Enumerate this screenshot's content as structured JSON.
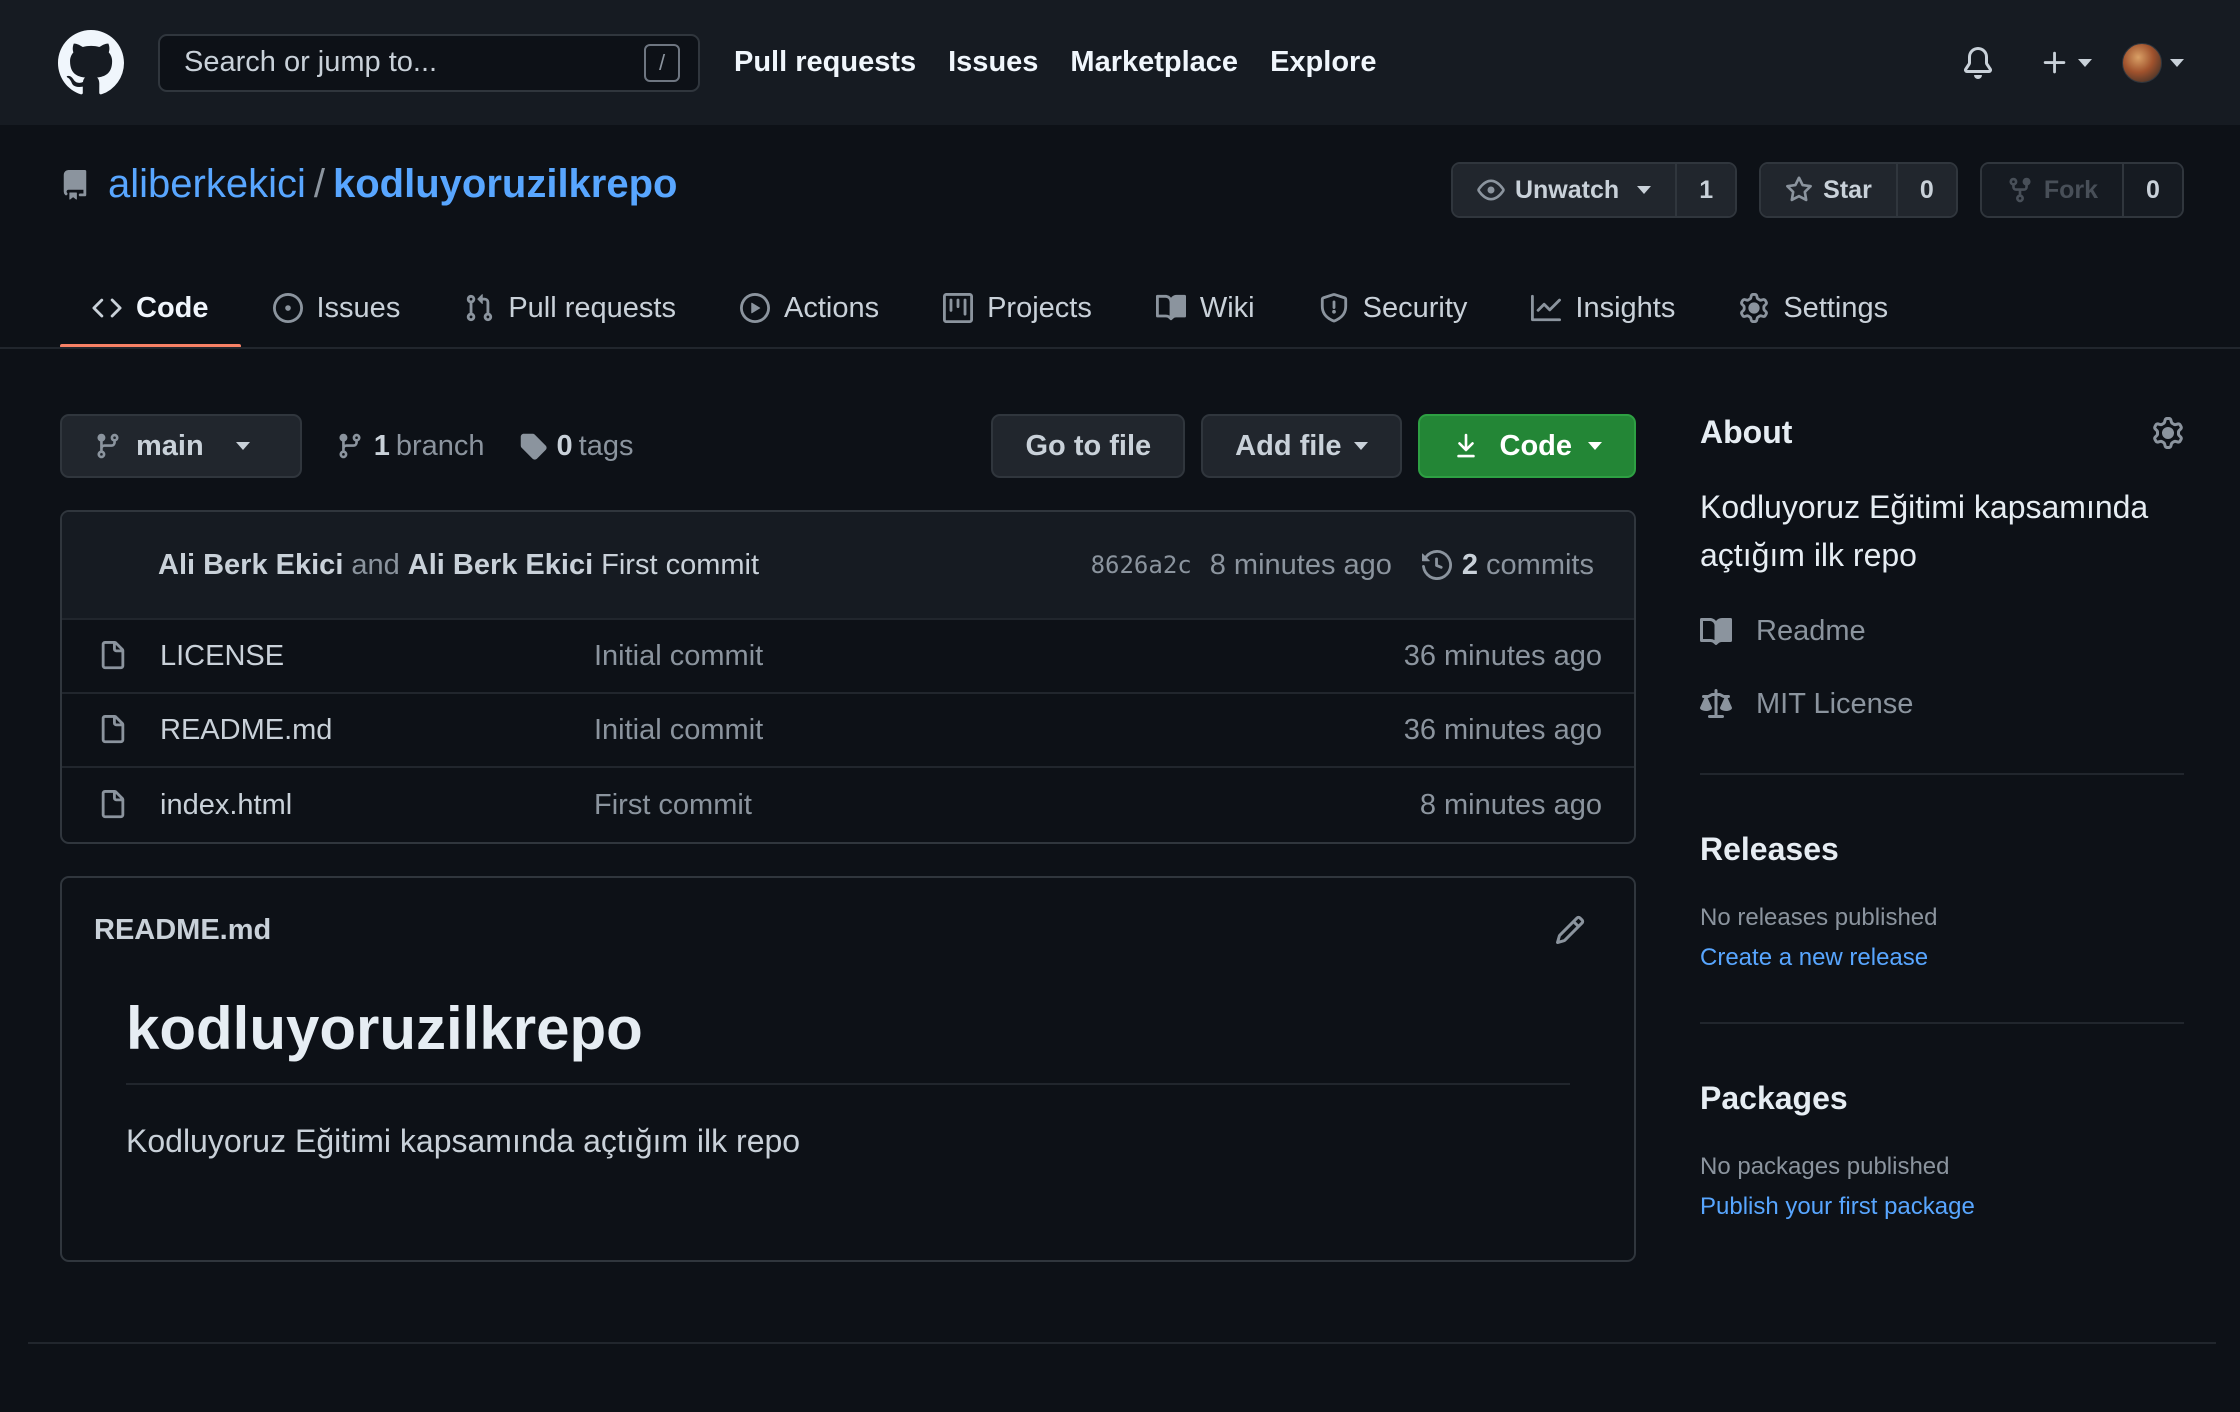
{
  "header": {
    "search_placeholder": "Search or jump to...",
    "search_shortcut": "/",
    "nav": [
      "Pull requests",
      "Issues",
      "Marketplace",
      "Explore"
    ]
  },
  "repo": {
    "owner": "aliberkekici",
    "separator": "/",
    "name": "kodluyoruzilkrepo",
    "watch_label": "Unwatch",
    "watch_count": "1",
    "star_label": "Star",
    "star_count": "0",
    "fork_label": "Fork",
    "fork_count": "0"
  },
  "tabs": [
    "Code",
    "Issues",
    "Pull requests",
    "Actions",
    "Projects",
    "Wiki",
    "Security",
    "Insights",
    "Settings"
  ],
  "filenav": {
    "branch": "main",
    "branch_count": "1",
    "branch_label": "branch",
    "tag_count": "0",
    "tag_label": "tags",
    "go_to_file": "Go to file",
    "add_file": "Add file",
    "code": "Code"
  },
  "commit": {
    "author1": "Ali Berk Ekici",
    "and": "and",
    "author2": "Ali Berk Ekici",
    "message": "First commit",
    "sha": "8626a2c",
    "age": "8 minutes ago",
    "commit_count": "2",
    "commit_label": "commits"
  },
  "files": [
    {
      "name": "LICENSE",
      "message": "Initial commit",
      "age": "36 minutes ago"
    },
    {
      "name": "README.md",
      "message": "Initial commit",
      "age": "36 minutes ago"
    },
    {
      "name": "index.html",
      "message": "First commit",
      "age": "8 minutes ago"
    }
  ],
  "readme": {
    "filename": "README.md",
    "heading": "kodluyoruzilkrepo",
    "body": "Kodluyoruz Eğitimi kapsamında açtığım ilk repo"
  },
  "sidebar": {
    "about_title": "About",
    "description": "Kodluyoruz Eğitimi kapsamında açtığım ilk repo",
    "readme_link": "Readme",
    "license_link": "MIT License",
    "releases_title": "Releases",
    "releases_empty": "No releases published",
    "releases_link": "Create a new release",
    "packages_title": "Packages",
    "packages_empty": "No packages published",
    "packages_link": "Publish your first package"
  }
}
